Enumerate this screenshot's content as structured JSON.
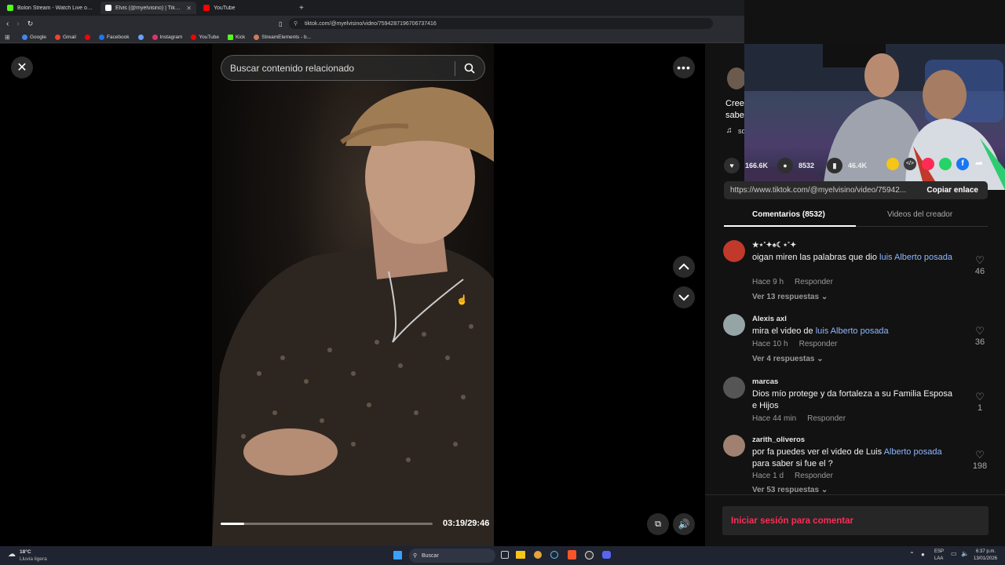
{
  "browser": {
    "tabs": [
      {
        "title": "Bolon Stream - Watch Live on Kick",
        "color": "#53fc18"
      },
      {
        "title": "Elvis (@myelvisino) | TikTok",
        "color": "#ffffff"
      },
      {
        "title": "YouTube",
        "color": "#ff0000"
      }
    ],
    "url": "tiktok.com/@myelvisino/video/7594287196706737416",
    "bookmarks": [
      {
        "label": "Google",
        "color": "#4285f4"
      },
      {
        "label": "Gmail",
        "color": "#ea4335"
      },
      {
        "label": "",
        "color": "#ff0000"
      },
      {
        "label": "Facebook",
        "color": "#1877f2"
      },
      {
        "label": "",
        "color": "#6aa0ff"
      },
      {
        "label": "Instagram",
        "color": "#e1306c"
      },
      {
        "label": "YouTube",
        "color": "#ff0000"
      },
      {
        "label": "Kick",
        "color": "#53fc18"
      },
      {
        "label": "StreamElements - b...",
        "color": "#c97c5d"
      }
    ]
  },
  "video": {
    "search_placeholder": "Buscar contenido relacionado",
    "time": "03:19/29:46",
    "progress": 0.11
  },
  "creator": {
    "caption_line1": "Cree",
    "caption_line2": "sabe",
    "sound_label": "so"
  },
  "stats": {
    "likes": "166.6K",
    "comments": "8532",
    "saves": "46.4K"
  },
  "share": {
    "link": "https://www.tiktok.com/@myelvisino/video/75942...",
    "copy_label": "Copiar enlace",
    "colors": [
      "#f5c518",
      "#3a3a3a",
      "#fe2c55",
      "#25d366",
      "#1877f2"
    ]
  },
  "tabs": {
    "comments_label": "Comentarios (8532)",
    "creator_videos_label": "Videos del creador"
  },
  "comments": [
    {
      "user": "★⋆˚✦♠☾⋆˚✦",
      "text_pre": "oigan miren las palabras que dio ",
      "text_hl": "luis Alberto posada",
      "text_post": "",
      "time": "Hace 9 h",
      "reply": "Responder",
      "replies": "Ver 13 respuestas",
      "likes": "46",
      "avatar_color": "#c0392b"
    },
    {
      "user": "Alexis axl",
      "text_pre": "mira el video de ",
      "text_hl": "luis Alberto posada",
      "text_post": "",
      "time": "Hace 10 h",
      "reply": "Responder",
      "replies": "Ver 4 respuestas",
      "likes": "36",
      "avatar_color": "#7f8c8d"
    },
    {
      "user": "marcas",
      "text_pre": "Dios mío protege y da fortaleza a su Familia Esposa e Hijos",
      "text_hl": "",
      "text_post": "",
      "time": "Hace 44 min",
      "reply": "Responder",
      "replies": "",
      "likes": "1",
      "avatar_color": "#555555"
    },
    {
      "user": "zarith_oliveros",
      "text_pre": "por fa puedes ver el video de Luis ",
      "text_hl": "Alberto posada",
      "text_post": " para saber si fue el ?",
      "time": "Hace 1 d",
      "reply": "Responder",
      "replies": "Ver 53 respuestas",
      "likes": "198",
      "avatar_color": "#a08070"
    }
  ],
  "login_prompt": "Iniciar sesión para comentar",
  "taskbar": {
    "weather_temp": "18°C",
    "weather_desc": "Lluvia ligera",
    "search_label": "Buscar",
    "lang_line1": "ESP",
    "lang_line2": "LAA",
    "clock_time": "6:37 p.m.",
    "clock_date": "13/01/2026"
  }
}
